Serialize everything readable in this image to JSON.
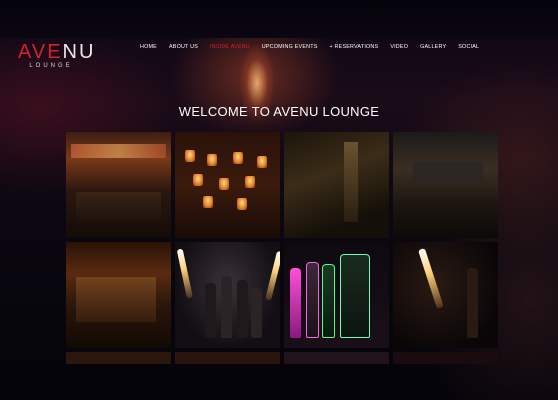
{
  "brand": {
    "logo_main_a": "AVE",
    "logo_main_b": "NU",
    "logo_sub": "LOUNGE",
    "accent_color": "#d2232a"
  },
  "nav": {
    "items": [
      {
        "label": "HOME",
        "active": false
      },
      {
        "label": "ABOUT US",
        "active": false
      },
      {
        "label": "INSIDE AVENU",
        "active": true
      },
      {
        "label": "UPCOMING EVENTS",
        "active": false
      },
      {
        "label": "+ RESERVATIONS",
        "active": false
      },
      {
        "label": "VIDEO",
        "active": false
      },
      {
        "label": "GALLERY",
        "active": false
      },
      {
        "label": "SOCIAL",
        "active": false
      }
    ]
  },
  "hero": {
    "title": "WELCOME TO AVENU LOUNGE"
  },
  "gallery": {
    "tiles": [
      "lounge-interior-bar",
      "candle-wall",
      "lounge-doorway",
      "booth-seating",
      "lounge-columns",
      "champagne-bottles-sparklers",
      "dom-perignon-bottles",
      "sparkler-bottle"
    ]
  }
}
